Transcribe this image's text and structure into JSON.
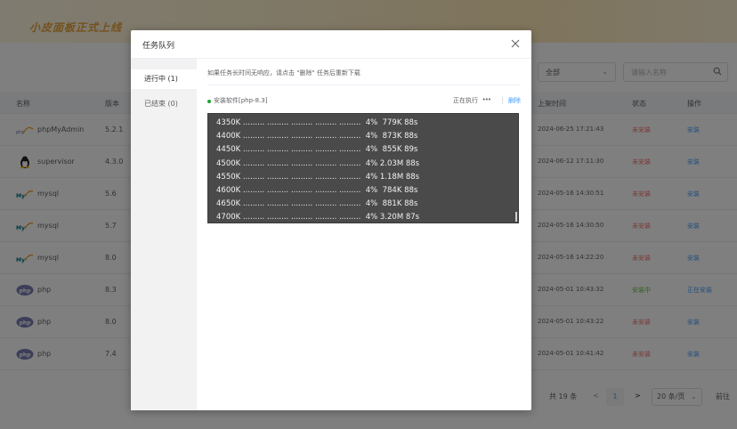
{
  "background": {
    "banner_title": "小皮面板正式上线",
    "filter": {
      "select_value": "全部",
      "search_placeholder": "请输入名称"
    },
    "table": {
      "headers": {
        "name": "名称",
        "version": "版本",
        "time": "上架时间",
        "status": "状态",
        "operation": "操作"
      },
      "rows": [
        {
          "name": "phpMyAdmin",
          "version": "5.2.1",
          "time": "2024-06-25 17:21:43",
          "status": "未安装",
          "operation": "安装",
          "icon": "phpmyadmin-icon"
        },
        {
          "name": "supervisor",
          "version": "4.3.0",
          "time": "2024-06-12 17:11:30",
          "status": "未安装",
          "operation": "安装",
          "icon": "linux-tux-icon"
        },
        {
          "name": "mysql",
          "version": "5.6",
          "time": "2024-05-16 14:30:51",
          "status": "未安装",
          "operation": "安装",
          "icon": "mysql-icon"
        },
        {
          "name": "mysql",
          "version": "5.7",
          "time": "2024-05-16 14:30:50",
          "status": "未安装",
          "operation": "安装",
          "icon": "mysql-icon"
        },
        {
          "name": "mysql",
          "version": "8.0",
          "time": "2024-05-16 14:22:20",
          "status": "未安装",
          "operation": "安装",
          "icon": "mysql-icon"
        },
        {
          "name": "php",
          "version": "8.3",
          "time": "2024-05-01 10:43:32",
          "status": "安装中",
          "operation": "正在安装",
          "icon": "php-icon"
        },
        {
          "name": "php",
          "version": "8.0",
          "time": "2024-05-01 10:43:22",
          "status": "未安装",
          "operation": "安装",
          "icon": "php-icon"
        },
        {
          "name": "php",
          "version": "7.4",
          "time": "2024-05-01 10:41:42",
          "status": "未安装",
          "operation": "安装",
          "icon": "php-icon"
        }
      ]
    },
    "pagination": {
      "total": "共 19 条",
      "prev": "<",
      "current_page": "1",
      "next": ">",
      "page_size": "20 条/页",
      "page_size_arrow": "⌄",
      "goto": "前往"
    }
  },
  "modal": {
    "title": "任务队列",
    "close_icon": "close-icon",
    "tabs": [
      {
        "label": "进行中 (1)",
        "active": true
      },
      {
        "label": "已结束 (0)",
        "active": false
      }
    ],
    "notice": "如果任务长时间无响应，请点击 \"删除\" 任务后重新下载",
    "task": {
      "name": "安装软件[php-8.3]",
      "status": "正在执行",
      "progress_dots": "•••",
      "delete_label": "删除"
    },
    "console_lines": [
      "4350K ......... ......... ......... ......... .........  4%  779K 88s",
      "4400K ......... ......... ......... ......... .........  4%  873K 88s",
      "4450K ......... ......... ......... ......... .........  4%  855K 89s",
      "4500K ......... ......... ......... ......... .........  4% 2.03M 88s",
      "4550K ......... ......... ......... ......... .........  4% 1.18M 88s",
      "4600K ......... ......... ......... ......... .........  4%  784K 88s",
      "4650K ......... ......... ......... ......... .........  4%  881K 88s",
      "4700K ......... ......... ......... ......... .........  4% 3.20M 87s"
    ]
  },
  "colors": {
    "primary": "#409eff",
    "not_installed": "#f56c6c",
    "installing": "#67c23a",
    "task_dot": "#20a53a",
    "console_bg": "#4a4a4a",
    "banner_text": "#e6a23c"
  }
}
